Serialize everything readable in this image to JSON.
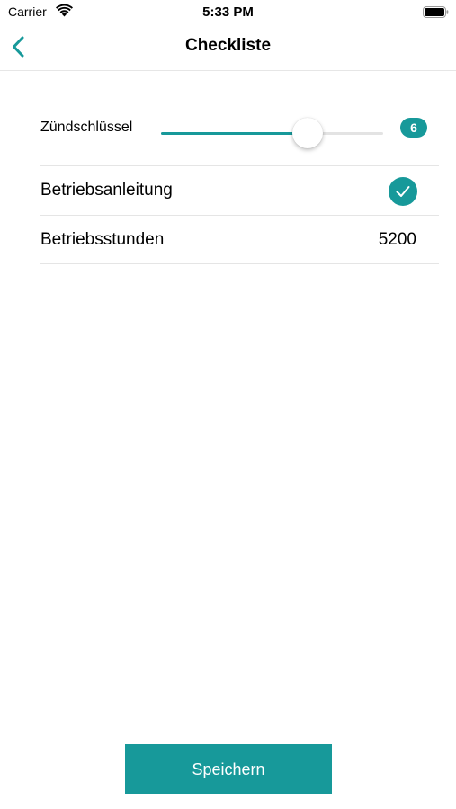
{
  "status_bar": {
    "carrier": "Carrier",
    "time": "5:33 PM",
    "wifi_icon": "wifi-icon",
    "battery_icon": "battery-full-icon"
  },
  "nav": {
    "back_icon": "chevron-left-icon",
    "title": "Checkliste"
  },
  "checklist": {
    "slider": {
      "label": "Zündschlüssel",
      "value": "6",
      "min": 0,
      "max": 10,
      "fill_fraction": 0.66
    },
    "manual": {
      "label": "Betriebsanleitung",
      "checked": true,
      "icon": "check-icon"
    },
    "hours": {
      "label": "Betriebsstunden",
      "value": "5200"
    }
  },
  "actions": {
    "save_label": "Speichern"
  },
  "colors": {
    "accent": "#17999a",
    "divider": "#e5e5e5",
    "track": "#e3e3e3"
  }
}
